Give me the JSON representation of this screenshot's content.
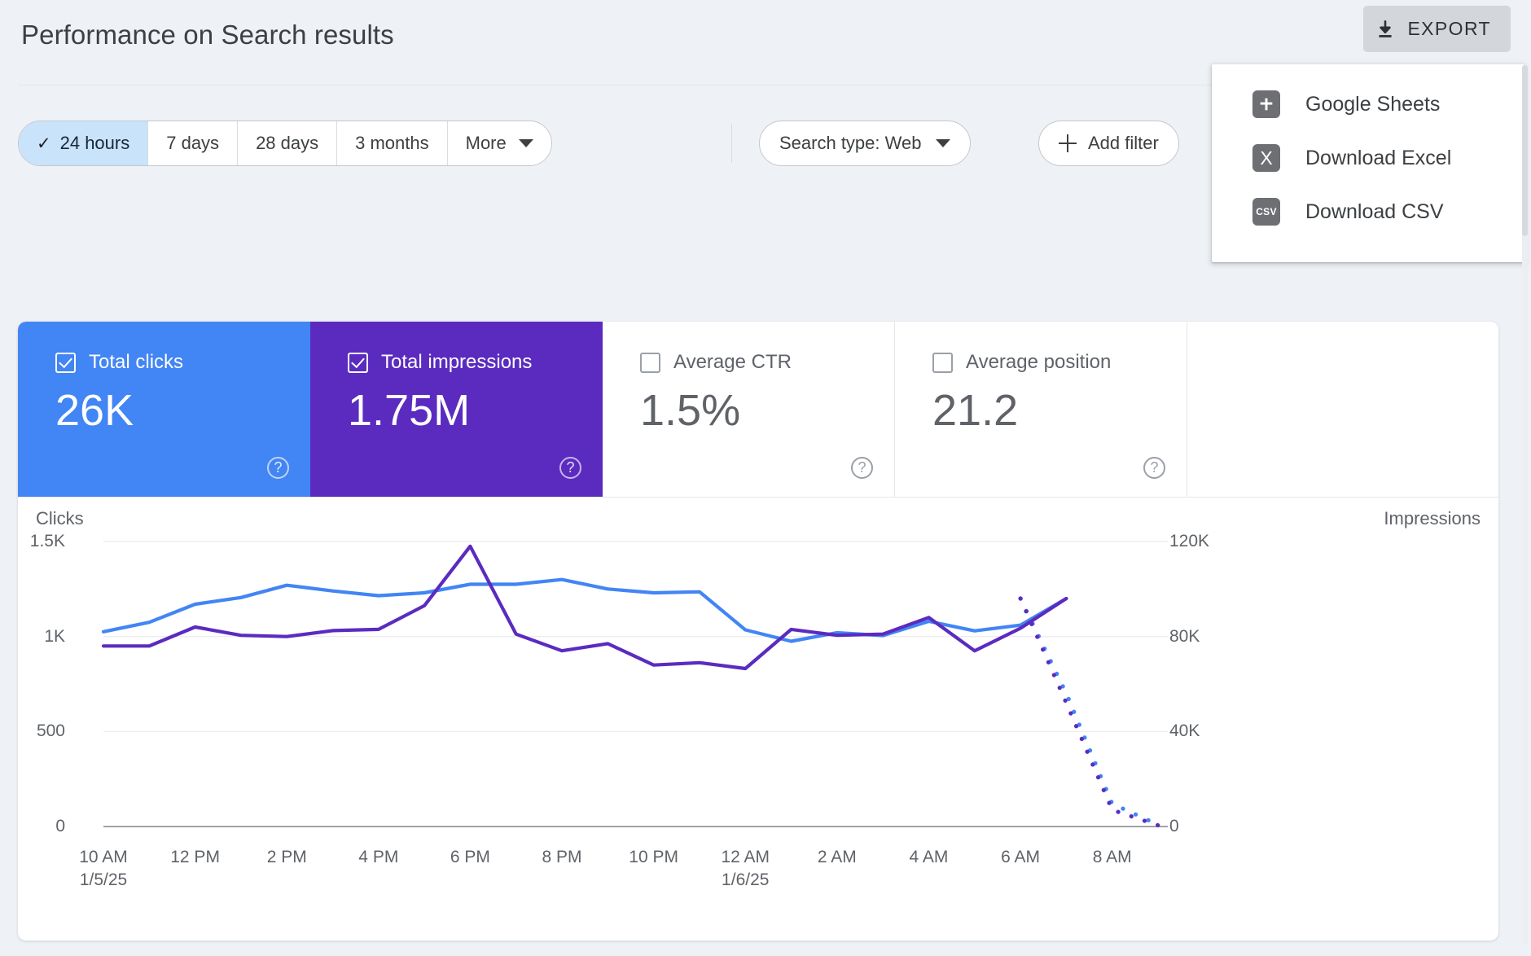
{
  "header": {
    "title": "Performance on Search results",
    "export_label": "EXPORT"
  },
  "export_menu": {
    "items": [
      {
        "label": "Google Sheets",
        "icon": "google-sheets-icon",
        "glyph": ""
      },
      {
        "label": "Download Excel",
        "icon": "excel-icon",
        "glyph": "X"
      },
      {
        "label": "Download CSV",
        "icon": "csv-icon",
        "glyph": "CSV"
      }
    ]
  },
  "filters": {
    "date_ranges": [
      {
        "label": "24 hours",
        "selected": true
      },
      {
        "label": "7 days",
        "selected": false
      },
      {
        "label": "28 days",
        "selected": false
      },
      {
        "label": "3 months",
        "selected": false
      },
      {
        "label": "More",
        "selected": false,
        "has_caret": true
      }
    ],
    "search_type": "Search type: Web",
    "add_filter": "Add filter",
    "check_glyph": "✓"
  },
  "metric_cards": [
    {
      "name": "Total clicks",
      "value": "26K",
      "checked": true,
      "color": "#4285f4",
      "help": "?"
    },
    {
      "name": "Total impressions",
      "value": "1.75M",
      "checked": true,
      "color": "#5b2bc0",
      "help": "?"
    },
    {
      "name": "Average CTR",
      "value": "1.5%",
      "checked": false,
      "color": "#ffffff",
      "help": "?"
    },
    {
      "name": "Average position",
      "value": "21.2",
      "checked": false,
      "color": "#ffffff",
      "help": "?"
    }
  ],
  "chart_data": {
    "type": "line",
    "title": "",
    "ylabel": "Clicks",
    "ylabel_right": "Impressions",
    "xlabel": "",
    "grid": true,
    "legend_position": "none",
    "ylim": [
      0,
      1500
    ],
    "ylim_right": [
      0,
      120000
    ],
    "yticks_left": [
      "1.5K",
      "1K",
      "500",
      "0"
    ],
    "yticks_left_values": [
      1500,
      1000,
      500,
      0
    ],
    "yticks_right": [
      "120K",
      "80K",
      "40K",
      "0"
    ],
    "yticks_right_values": [
      120000,
      80000,
      40000,
      0
    ],
    "xticks": [
      "10 AM\n1/5/25",
      "12 PM",
      "2 PM",
      "4 PM",
      "6 PM",
      "8 PM",
      "10 PM",
      "12 AM\n1/6/25",
      "2 AM",
      "4 AM",
      "6 AM",
      "8 AM"
    ],
    "x": [
      "10 AM",
      "11 AM",
      "12 PM",
      "1 PM",
      "2 PM",
      "3 PM",
      "4 PM",
      "5 PM",
      "6 PM",
      "7 PM",
      "8 PM",
      "9 PM",
      "10 PM",
      "11 PM",
      "12 AM",
      "1 AM",
      "2 AM",
      "3 AM",
      "4 AM",
      "5 AM",
      "6 AM",
      "7 AM",
      "8 AM",
      "9 AM"
    ],
    "series": [
      {
        "name": "Total clicks",
        "color": "#4285f4",
        "axis": "left",
        "style": "solid",
        "values": [
          1025,
          1075,
          1170,
          1205,
          1270,
          1240,
          1215,
          1230,
          1275,
          1275,
          1300,
          1250,
          1230,
          1235,
          1035,
          975,
          1020,
          1005,
          1080,
          1030,
          1060,
          1200,
          null,
          null
        ],
        "projected_values": [
          null,
          null,
          null,
          null,
          null,
          null,
          null,
          null,
          null,
          null,
          null,
          null,
          null,
          null,
          null,
          null,
          null,
          null,
          null,
          null,
          1200,
          700,
          120,
          10
        ]
      },
      {
        "name": "Total impressions",
        "color": "#5b2bc0",
        "axis": "right",
        "style": "solid",
        "values": [
          76000,
          76000,
          84000,
          80500,
          80000,
          82500,
          83000,
          93000,
          118000,
          81000,
          74000,
          77000,
          68000,
          69000,
          66500,
          83000,
          80500,
          81000,
          88000,
          74000,
          83500,
          96000,
          null,
          null
        ],
        "projected_values": [
          null,
          null,
          null,
          null,
          null,
          null,
          null,
          null,
          null,
          null,
          null,
          null,
          null,
          null,
          null,
          null,
          null,
          null,
          null,
          null,
          96000,
          52000,
          7000,
          500
        ]
      }
    ]
  }
}
